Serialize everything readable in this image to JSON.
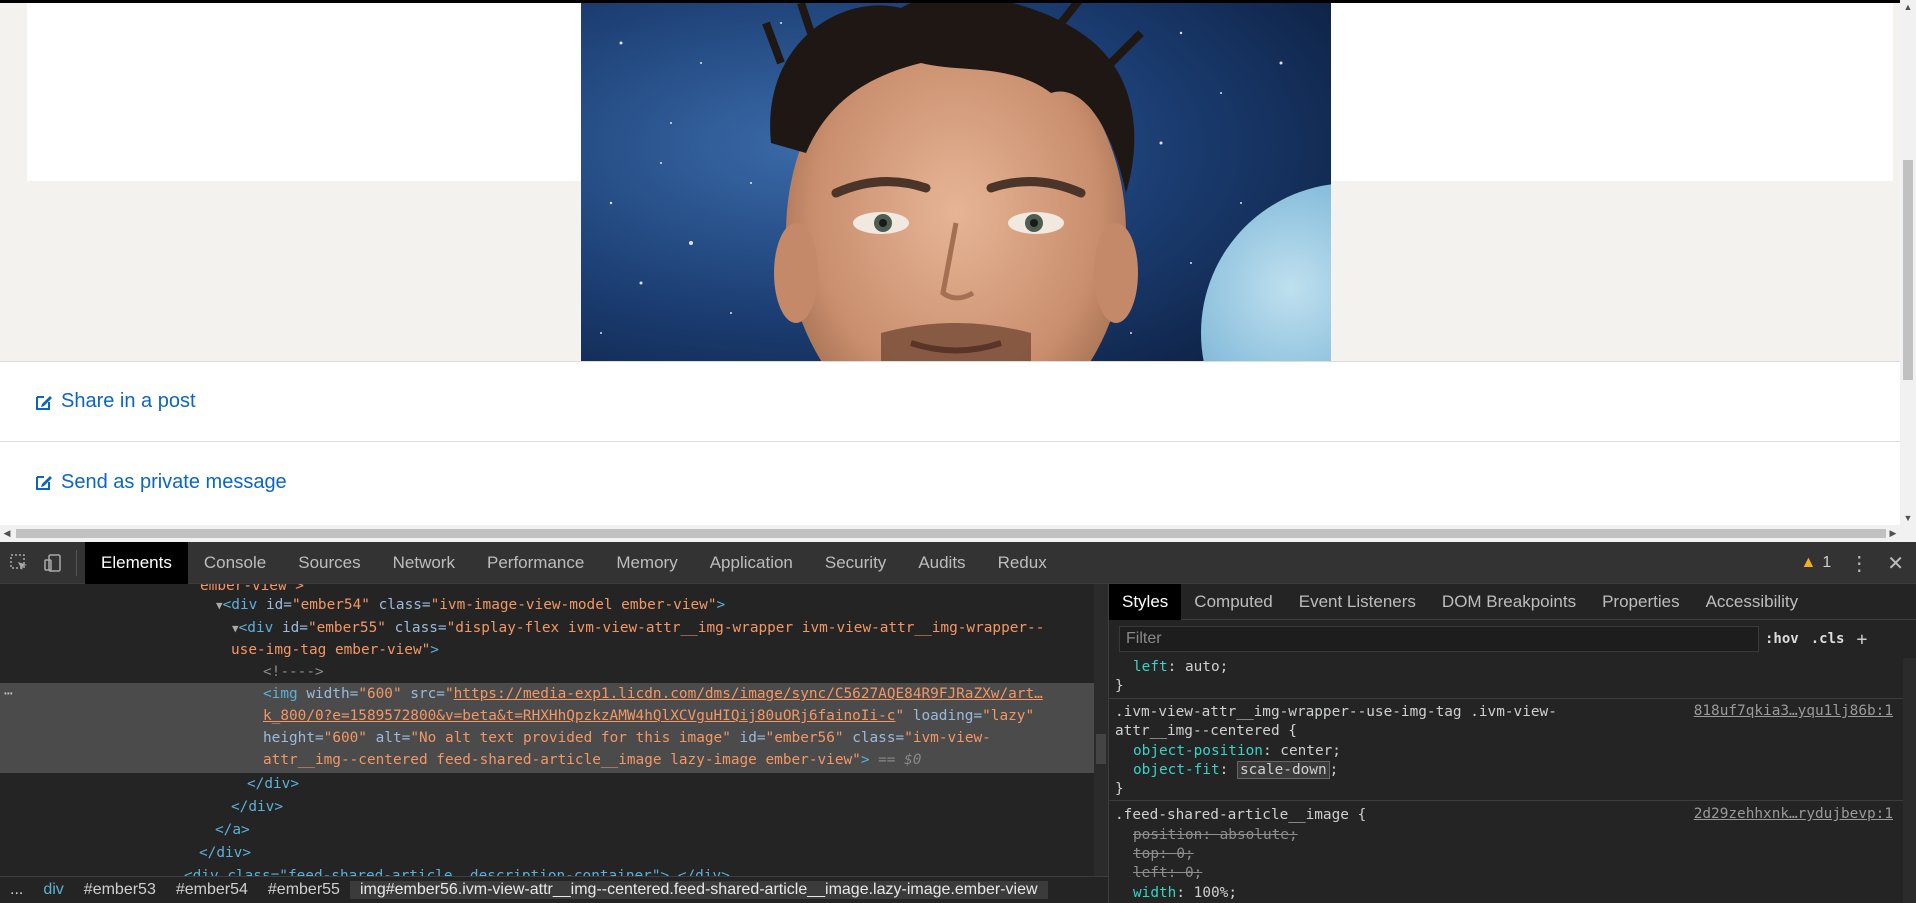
{
  "page": {
    "actions": [
      {
        "label": "Share in a post",
        "icon": "edit-icon"
      },
      {
        "label": "Send as private message",
        "icon": "edit-icon"
      }
    ]
  },
  "devtools": {
    "tabs": [
      "Elements",
      "Console",
      "Sources",
      "Network",
      "Performance",
      "Memory",
      "Application",
      "Security",
      "Audits",
      "Redux"
    ],
    "active_tab": "Elements",
    "warning_count": "1",
    "elements": {
      "line0": "ember-view\">",
      "line1_tag": "<div",
      "line1_id_attr": " id=",
      "line1_id_val": "\"ember54\"",
      "line1_class_attr": " class=",
      "line1_class_val": "\"ivm-image-view-model ember-view\"",
      "line1_end": ">",
      "line2_tag": "<div",
      "line2_id_attr": " id=",
      "line2_id_val": "\"ember55\"",
      "line2_class_attr": " class=",
      "line2_class_val_a": "\"display-flex ivm-view-attr__img-wrapper ivm-view-attr__img-wrapper--",
      "line2_class_val_b": "use-img-tag ember-view\"",
      "line2_end": ">",
      "comment": "<!---->",
      "img_tag": "<img",
      "img_width_attr": " width=",
      "img_width_val": "\"600\"",
      "img_src_attr": " src=",
      "img_src_q": "\"",
      "img_src_a": "https://media-exp1.licdn.com/dms/image/sync/C5627AQE84R9FJRaZXw/art…",
      "img_src_b": "k_800/0?e=1589572800&v=beta&t=RHXHhQpzkzAMW4hQlXCVguHIQij80uORj6fainoIi-c",
      "img_src_q2": "\"",
      "img_loading_attr": " loading=",
      "img_loading_val": "\"lazy\"",
      "img_height_attr": "height=",
      "img_height_val": "\"600\"",
      "img_alt_attr": " alt=",
      "img_alt_val": "\"No alt text provided for this image\"",
      "img_id_attr": " id=",
      "img_id_val": "\"ember56\"",
      "img_class_attr": " class=",
      "img_class_val_a": "\"ivm-view-",
      "img_class_val_b": "attr__img--centered feed-shared-article__image lazy-image ember-view\"",
      "img_end": ">",
      "eq_sel": " == $0",
      "close_div": "</div>",
      "close_a": "</a>",
      "partial_last": "<div class=\"feed-shared-article__description-container\">…</div>"
    },
    "breadcrumbs": [
      "...",
      "div",
      "#ember53",
      "#ember54",
      "#ember55",
      "img#ember56.ivm-view-attr__img--centered.feed-shared-article__image.lazy-image.ember-view"
    ],
    "styles": {
      "tabs": [
        "Styles",
        "Computed",
        "Event Listeners",
        "DOM Breakpoints",
        "Properties",
        "Accessibility"
      ],
      "active_tab": "Styles",
      "filter_placeholder": "Filter",
      "hov": ":hov",
      "cls": ".cls",
      "plus": "+",
      "rule0_prop": "left",
      "rule0_val": "auto",
      "rule1_selector_a": ".ivm-view-attr__img-wrapper--use-img-tag .ivm-view-",
      "rule1_selector_b": "attr__img--centered {",
      "rule1_source": "818uf7qkia3…yqu1lj86b:1",
      "rule1_p1": "object-position",
      "rule1_v1": "center",
      "rule1_p2": "object-fit",
      "rule1_v2": "scale-down",
      "rule2_selector": ".feed-shared-article__image {",
      "rule2_source": "2d29zehhxnk…rydujbevp:1",
      "rule2_p1": "position",
      "rule2_v1": "absolute",
      "rule2_p2": "top",
      "rule2_v2": "0",
      "rule2_p3": "left",
      "rule2_v3": "0",
      "rule2_p4": "width",
      "rule2_v4": "100%",
      "close_brace": "}"
    }
  },
  "colors": {
    "link_blue": "#0a66c2",
    "devtools_bg": "#242424",
    "warning_yellow": "#f2b01e"
  }
}
